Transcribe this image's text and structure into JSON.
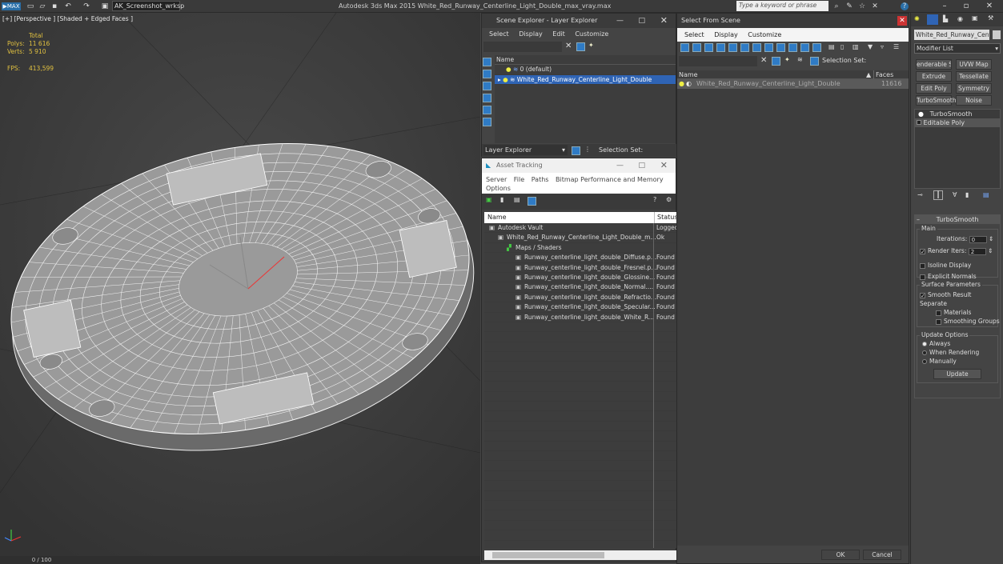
{
  "titlebar": {
    "workspace": "AK_Screenshot_wrksp",
    "title": "Autodesk 3ds Max  2015    White_Red_Runway_Centerline_Light_Double_max_vray.max",
    "search_placeholder": "Type a keyword or phrase"
  },
  "viewport": {
    "label": "[+] [Perspective ] [Shaded + Edged Faces ]",
    "stats": {
      "total": "Total",
      "polys_label": "Polys:",
      "polys": "11 616",
      "verts_label": "Verts:",
      "verts": "5 910",
      "fps_label": "FPS:",
      "fps": "413,599"
    },
    "timeline": "0 / 100"
  },
  "scene_explorer": {
    "title": "Scene Explorer - Layer Explorer",
    "menu": [
      "Select",
      "Display",
      "Edit",
      "Customize"
    ],
    "col_name": "Name",
    "rows": [
      "0 (default)",
      "White_Red_Runway_Centerline_Light_Double"
    ],
    "footer_dropdown": "Layer Explorer",
    "selection_set": "Selection Set:"
  },
  "asset_tracking": {
    "title": "Asset Tracking",
    "menu": [
      "Server",
      "File",
      "Paths",
      "Bitmap Performance and Memory"
    ],
    "menu2": "Options",
    "col_name": "Name",
    "col_status": "Status",
    "rows": [
      {
        "name": "Autodesk Vault",
        "status": "Logged",
        "indent": 0
      },
      {
        "name": "White_Red_Runway_Centerline_Light_Double_m...",
        "status": "Ok",
        "indent": 1
      },
      {
        "name": "Maps / Shaders",
        "status": "",
        "indent": 2
      },
      {
        "name": "Runway_centerline_light_double_Diffuse.p...",
        "status": "Found",
        "indent": 3
      },
      {
        "name": "Runway_centerline_light_double_Fresnel.p...",
        "status": "Found",
        "indent": 3
      },
      {
        "name": "Runway_centerline_light_double_Glossine...",
        "status": "Found",
        "indent": 3
      },
      {
        "name": "Runway_centerline_light_double_Normal....",
        "status": "Found",
        "indent": 3
      },
      {
        "name": "Runway_centerline_light_double_Refractio...",
        "status": "Found",
        "indent": 3
      },
      {
        "name": "Runway_centerline_light_double_Specular...",
        "status": "Found",
        "indent": 3
      },
      {
        "name": "Runway_centerline_light_double_White_R...",
        "status": "Found",
        "indent": 3
      }
    ]
  },
  "select_from_scene": {
    "title": "Select From Scene",
    "menu": [
      "Select",
      "Display",
      "Customize"
    ],
    "selection_set": "Selection Set:",
    "col_name": "Name",
    "col_faces": "Faces",
    "rows": [
      {
        "name": "White_Red_Runway_Centerline_Light_Double",
        "faces": "11616"
      }
    ],
    "ok": "OK",
    "cancel": "Cancel"
  },
  "command_panel": {
    "object_name": "White_Red_Runway_Centerli",
    "modifier_list": "Modifier List",
    "buttons": [
      "enderable Spline",
      "UVW Map",
      "Extrude",
      "Tessellate",
      "Edit Poly",
      "Symmetry",
      "TurboSmooth",
      "Noise"
    ],
    "stack": [
      "TurboSmooth",
      "Editable Poly"
    ],
    "rollout_title": "TurboSmooth",
    "main": "Main",
    "iterations_label": "Iterations:",
    "iterations": "0",
    "render_iters_label": "Render Iters:",
    "render_iters": "2",
    "isoline": "Isoline Display",
    "explicit_normals": "Explicit Normals",
    "surface_params": "Surface Parameters",
    "smooth_result": "Smooth Result",
    "separate": "Separate",
    "materials": "Materials",
    "smoothing_groups": "Smoothing Groups",
    "update_options": "Update Options",
    "always": "Always",
    "when_rendering": "When Rendering",
    "manually": "Manually",
    "update": "Update"
  }
}
